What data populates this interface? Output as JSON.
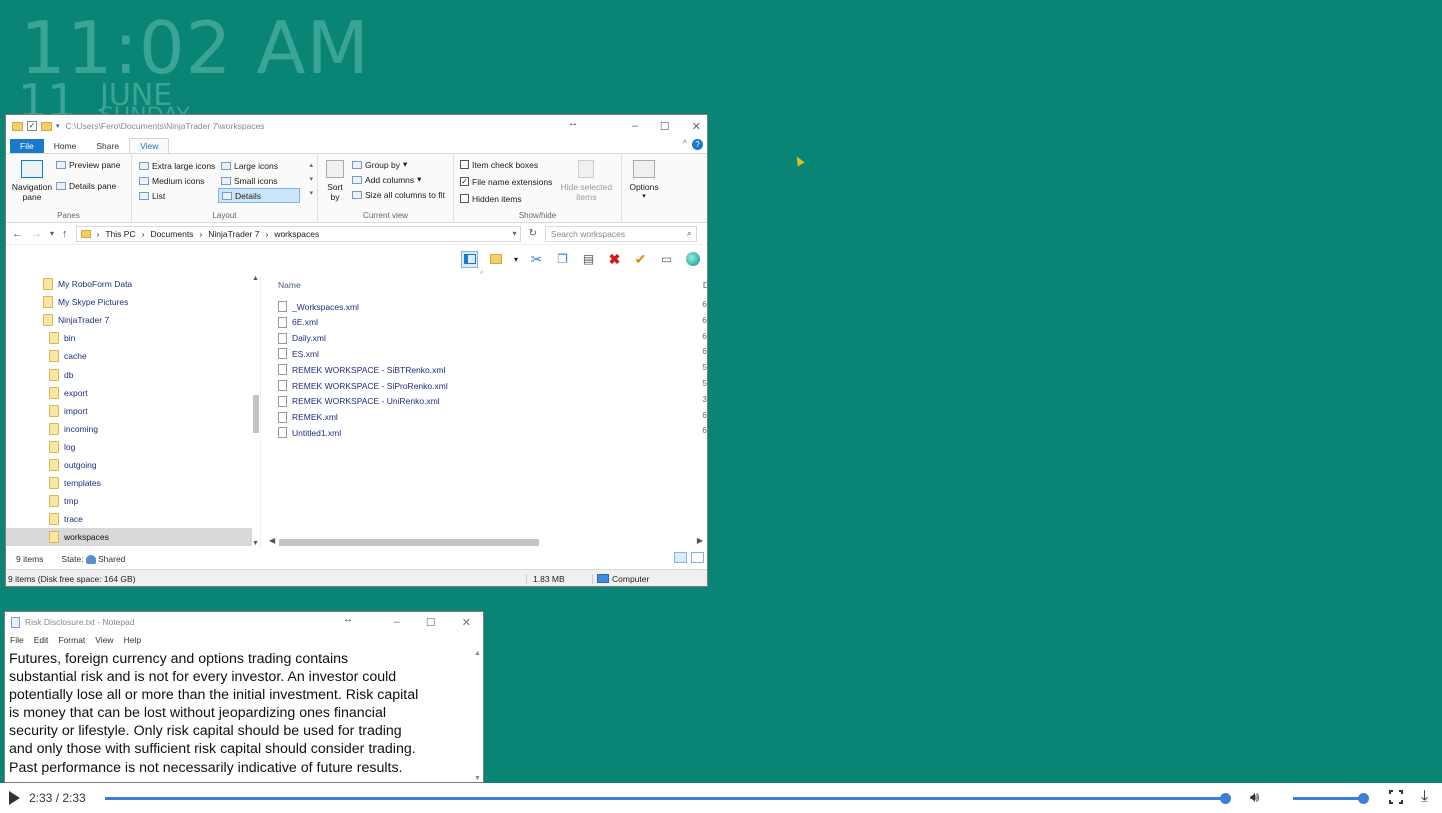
{
  "desktop": {
    "time": "11:02 AM",
    "day": "11",
    "month": "JUNE",
    "weekday": "SUNDAY"
  },
  "explorer": {
    "title_path": "C:\\Users\\Fero\\Documents\\NinjaTrader 7\\workspaces",
    "tabs": [
      "File",
      "Home",
      "Share",
      "View"
    ],
    "ribbon": {
      "panes": {
        "navigation_pane": "Navigation pane",
        "preview_pane": "Preview pane",
        "details_pane": "Details pane",
        "label": "Panes"
      },
      "layout": {
        "items": [
          "Extra large icons",
          "Large icons",
          "Medium icons",
          "Small icons",
          "List",
          "Details"
        ],
        "selected": "Details",
        "label": "Layout"
      },
      "current_view": {
        "sort_by": "Sort by",
        "group_by": "Group by",
        "add_columns": "Add columns",
        "size_all_columns": "Size all columns to fit",
        "label": "Current view"
      },
      "show_hide": {
        "item_check_boxes": "Item check boxes",
        "file_name_extensions": "File name extensions",
        "hidden_items": "Hidden items",
        "hide_selected_items": "Hide selected items",
        "label": "Show/hide",
        "checks": {
          "item_check_boxes": false,
          "file_name_extensions": true,
          "hidden_items": false
        }
      },
      "options": "Options"
    },
    "breadcrumb": [
      "This PC",
      "Documents",
      "NinjaTrader 7",
      "workspaces"
    ],
    "search_placeholder": "Search workspaces",
    "nav_items": [
      {
        "label": "My RoboForm Data",
        "indent": 1
      },
      {
        "label": "My Skype Pictures",
        "indent": 1
      },
      {
        "label": "NinjaTrader 7",
        "indent": 1
      },
      {
        "label": "bin",
        "indent": 2
      },
      {
        "label": "cache",
        "indent": 2
      },
      {
        "label": "db",
        "indent": 2
      },
      {
        "label": "export",
        "indent": 2
      },
      {
        "label": "import",
        "indent": 2
      },
      {
        "label": "incoming",
        "indent": 2
      },
      {
        "label": "log",
        "indent": 2
      },
      {
        "label": "outgoing",
        "indent": 2
      },
      {
        "label": "templates",
        "indent": 2
      },
      {
        "label": "tmp",
        "indent": 2
      },
      {
        "label": "trace",
        "indent": 2
      },
      {
        "label": "workspaces",
        "indent": 2,
        "selected": true
      }
    ],
    "columns": {
      "name": "Name",
      "date_cut": "D"
    },
    "files": [
      {
        "name": "_Workspaces.xml",
        "cut": "6,"
      },
      {
        "name": "6E.xml",
        "cut": "6,"
      },
      {
        "name": "Daily.xml",
        "cut": "6,"
      },
      {
        "name": "ES.xml",
        "cut": "6,"
      },
      {
        "name": "REMEK WORKSPACE - SiBTRenko.xml",
        "cut": "5,"
      },
      {
        "name": "REMEK WORKSPACE - SiProRenko.xml",
        "cut": "5,"
      },
      {
        "name": "REMEK WORKSPACE - UniRenko.xml",
        "cut": "3,"
      },
      {
        "name": "REMEK.xml",
        "cut": "6,"
      },
      {
        "name": "Untitled1.xml",
        "cut": "6,"
      }
    ],
    "status": {
      "items": "9 items",
      "state": "State:",
      "state_value": "Shared",
      "free_space": "9 items (Disk free space: 164 GB)",
      "size": "1.83 MB",
      "location": "Computer"
    }
  },
  "notepad": {
    "title": "Risk Disclosure.txt - Notepad",
    "menu": [
      "File",
      "Edit",
      "Format",
      "View",
      "Help"
    ],
    "lines": [
      "Futures, foreign currency and options trading contains",
      "substantial risk and is not for every investor. An investor could",
      "potentially lose all or more than the initial investment. Risk capital",
      "is money that can be lost without jeopardizing ones financial",
      "security or lifestyle. Only risk capital should be used for trading",
      "and only those with sufficient risk capital should consider trading.",
      "Past performance is not necessarily indicative of future results."
    ]
  },
  "player": {
    "time": "2:33 / 2:33",
    "progress": 1.0,
    "volume": 1.0
  }
}
